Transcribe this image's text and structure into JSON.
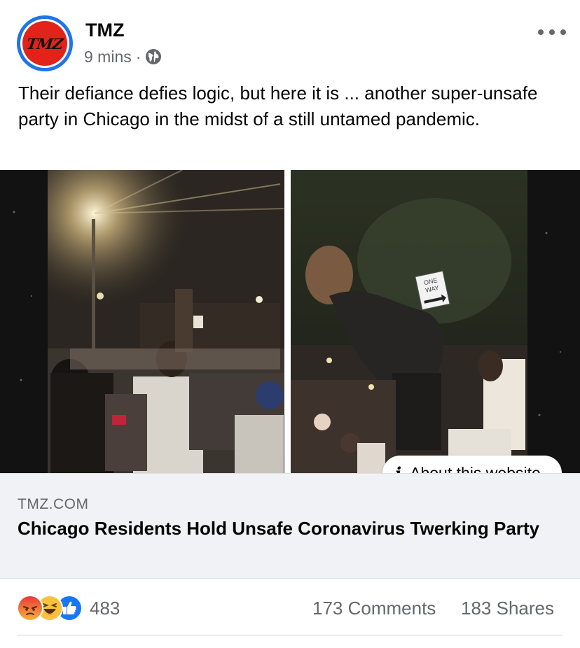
{
  "post": {
    "page_name": "TMZ",
    "avatar_text": "TMZ",
    "time": "9 mins",
    "separator": "·",
    "audience_icon": "globe-icon",
    "more_icon": "more-horizontal-icon",
    "caption": "Their defiance defies logic, but here it is ... another super-unsafe party in Chicago in the midst of a still untamed pandemic."
  },
  "link_preview": {
    "image_sign_text": [
      "ONE",
      "WAY"
    ],
    "about_label": "About this website",
    "about_icon": "info-icon",
    "domain": "TMZ.COM",
    "title": "Chicago Residents Hold Unsafe Coronavirus Twerking Party"
  },
  "engagement": {
    "reaction_icons": [
      "angry-reaction-icon",
      "haha-reaction-icon",
      "like-reaction-icon"
    ],
    "reaction_count": "483",
    "comments": "173 Comments",
    "shares": "183 Shares"
  },
  "colors": {
    "accent_blue": "#1877f2",
    "tmz_red": "#e2231a",
    "secondary_text": "#65676b",
    "link_box_bg": "#f0f2f5"
  }
}
